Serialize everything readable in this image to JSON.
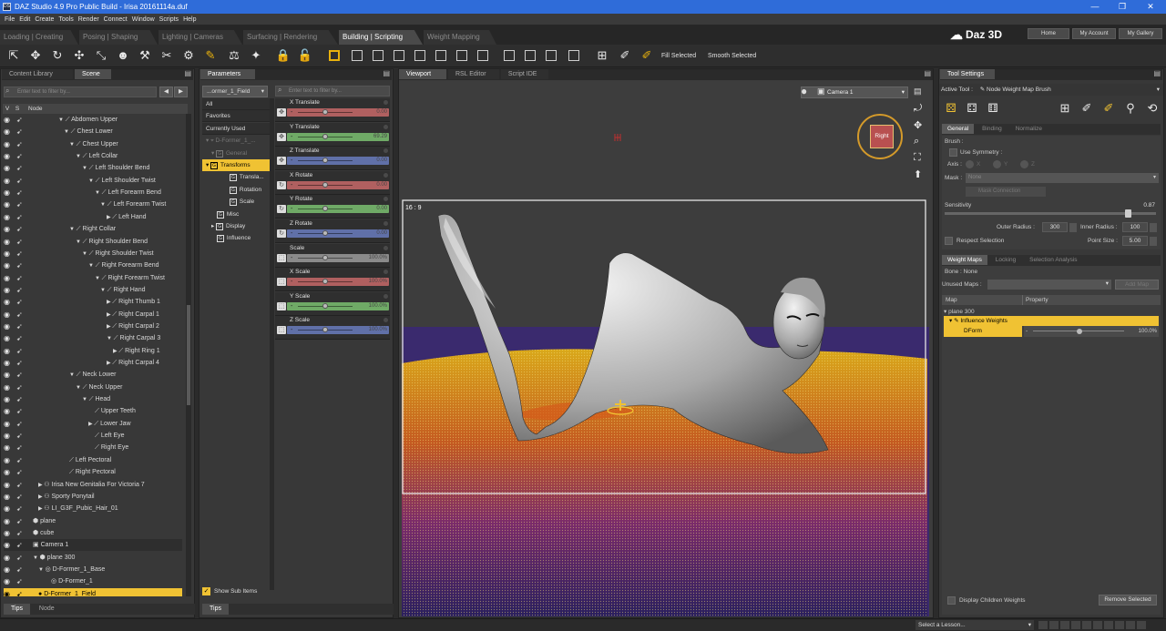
{
  "window": {
    "title": "DAZ Studio 4.9 Pro Public Build - Irisa 20161114a.duf",
    "app_icon": "DS"
  },
  "menu": [
    "File",
    "Edit",
    "Create",
    "Tools",
    "Render",
    "Connect",
    "Window",
    "Scripts",
    "Help"
  ],
  "rooms": [
    {
      "label": "Loading | Creating",
      "active": false
    },
    {
      "label": "Posing | Shaping",
      "active": false
    },
    {
      "label": "Lighting | Cameras",
      "active": false
    },
    {
      "label": "Surfacing | Rendering",
      "active": false
    },
    {
      "label": "Building | Scripting",
      "active": true
    },
    {
      "label": "Weight Mapping",
      "active": false
    }
  ],
  "top_buttons": {
    "home": "Home",
    "account": "My Account",
    "gallery": "My Gallery",
    "logo": "Daz 3D"
  },
  "toolbar": {
    "fill_selected": "Fill Selected",
    "smooth_selected": "Smooth Selected"
  },
  "left_panel": {
    "tabs": [
      "Content Library",
      "Scene"
    ],
    "filter_placeholder": "Enter text to filter by...",
    "header": {
      "v": "V",
      "s": "S",
      "node": "Node"
    },
    "nodes": [
      {
        "label": "Abdomen Upper",
        "indent": 60,
        "arrow": "▼",
        "icon": "bone"
      },
      {
        "label": "Chest Lower",
        "indent": 66,
        "arrow": "▼",
        "icon": "bone"
      },
      {
        "label": "Chest Upper",
        "indent": 72,
        "arrow": "▼",
        "icon": "bone"
      },
      {
        "label": "Left Collar",
        "indent": 79,
        "arrow": "▼",
        "icon": "bone"
      },
      {
        "label": "Left Shoulder Bend",
        "indent": 86,
        "arrow": "▼",
        "icon": "bone"
      },
      {
        "label": "Left Shoulder Twist",
        "indent": 93,
        "arrow": "▼",
        "icon": "bone"
      },
      {
        "label": "Left Forearm Bend",
        "indent": 100,
        "arrow": "▼",
        "icon": "bone"
      },
      {
        "label": "Left Forearm Twist",
        "indent": 106,
        "arrow": "▼",
        "icon": "bone"
      },
      {
        "label": "Left Hand",
        "indent": 113,
        "arrow": "▶",
        "icon": "bone"
      },
      {
        "label": "Right Collar",
        "indent": 72,
        "arrow": "▼",
        "icon": "bone"
      },
      {
        "label": "Right Shoulder Bend",
        "indent": 79,
        "arrow": "▼",
        "icon": "bone"
      },
      {
        "label": "Right Shoulder Twist",
        "indent": 86,
        "arrow": "▼",
        "icon": "bone"
      },
      {
        "label": "Right Forearm Bend",
        "indent": 93,
        "arrow": "▼",
        "icon": "bone"
      },
      {
        "label": "Right Forearm Twist",
        "indent": 100,
        "arrow": "▼",
        "icon": "bone"
      },
      {
        "label": "Right Hand",
        "indent": 106,
        "arrow": "▼",
        "icon": "bone"
      },
      {
        "label": "Right Thumb 1",
        "indent": 113,
        "arrow": "▶",
        "icon": "bone"
      },
      {
        "label": "Right Carpal 1",
        "indent": 113,
        "arrow": "▶",
        "icon": "bone"
      },
      {
        "label": "Right Carpal 2",
        "indent": 113,
        "arrow": "▶",
        "icon": "bone"
      },
      {
        "label": "Right Carpal 3",
        "indent": 113,
        "arrow": "▼",
        "icon": "bone"
      },
      {
        "label": "Right Ring 1",
        "indent": 120,
        "arrow": "▶",
        "icon": "bone"
      },
      {
        "label": "Right Carpal 4",
        "indent": 113,
        "arrow": "▶",
        "icon": "bone"
      },
      {
        "label": "Neck Lower",
        "indent": 72,
        "arrow": "▼",
        "icon": "bone"
      },
      {
        "label": "Neck Upper",
        "indent": 79,
        "arrow": "▼",
        "icon": "bone"
      },
      {
        "label": "Head",
        "indent": 86,
        "arrow": "▼",
        "icon": "bone"
      },
      {
        "label": "Upper Teeth",
        "indent": 100,
        "arrow": "",
        "icon": "bone"
      },
      {
        "label": "Lower Jaw",
        "indent": 93,
        "arrow": "▶",
        "icon": "bone"
      },
      {
        "label": "Left Eye",
        "indent": 100,
        "arrow": "",
        "icon": "bone"
      },
      {
        "label": "Right Eye",
        "indent": 100,
        "arrow": "",
        "icon": "bone"
      },
      {
        "label": "Left Pectoral",
        "indent": 72,
        "arrow": "",
        "icon": "bone"
      },
      {
        "label": "Right Pectoral",
        "indent": 72,
        "arrow": "",
        "icon": "bone"
      },
      {
        "label": "Irisa New Genitalia For Victoria 7",
        "indent": 38,
        "arrow": "▶",
        "icon": "figure"
      },
      {
        "label": "Sporty Ponytail",
        "indent": 38,
        "arrow": "▶",
        "icon": "figure"
      },
      {
        "label": "LI_G3F_Pubic_Hair_01",
        "indent": 38,
        "arrow": "▶",
        "icon": "figure"
      },
      {
        "label": "plane",
        "indent": 32,
        "arrow": "",
        "icon": "prop"
      },
      {
        "label": "cube",
        "indent": 32,
        "arrow": "",
        "icon": "prop"
      },
      {
        "label": "Camera 1",
        "indent": 32,
        "arrow": "",
        "icon": "camera"
      },
      {
        "label": "plane 300",
        "indent": 32,
        "arrow": "▼",
        "icon": "prop"
      },
      {
        "label": "D-Former_1_Base",
        "indent": 38,
        "arrow": "▼",
        "icon": "dformer"
      },
      {
        "label": "D-Former_1",
        "indent": 52,
        "arrow": "",
        "icon": "dformer"
      },
      {
        "label": "D-Former_1_Field",
        "indent": 38,
        "arrow": "",
        "icon": "field",
        "highlight": true
      }
    ],
    "bottom_tabs": [
      "Tips",
      "Node"
    ]
  },
  "params_panel": {
    "tab": "Parameters",
    "node_select": "...ormer_1_Field",
    "filter_placeholder": "Enter text to filter by...",
    "categories": [
      {
        "label": "All"
      },
      {
        "label": "Favorites"
      },
      {
        "label": "Currently Used"
      },
      {
        "label": "D-Former_1_...",
        "dim": true
      },
      {
        "label": "General",
        "dim": true
      },
      {
        "label": "Transforms",
        "highlight": true
      },
      {
        "label": "Transla..."
      },
      {
        "label": "Rotation"
      },
      {
        "label": "Scale"
      },
      {
        "label": "Misc"
      },
      {
        "label": "Display"
      },
      {
        "label": "Influence"
      }
    ],
    "rows": [
      {
        "label": "X Translate",
        "value": "0.00",
        "color": "#b06060",
        "icon": "move",
        "knob": 0.5
      },
      {
        "label": "Y Translate",
        "value": "69.29",
        "color": "#6faa66",
        "icon": "move",
        "knob": 0.5
      },
      {
        "label": "Z Translate",
        "value": "0.00",
        "color": "#6070a8",
        "icon": "move",
        "knob": 0.5
      },
      {
        "label": "X Rotate",
        "value": "0.00",
        "color": "#b06060",
        "icon": "rotate",
        "knob": 0.5
      },
      {
        "label": "Y Rotate",
        "value": "0.00",
        "color": "#6faa66",
        "icon": "rotate",
        "knob": 0.5
      },
      {
        "label": "Z Rotate",
        "value": "0.00",
        "color": "#6070a8",
        "icon": "rotate",
        "knob": 0.5
      },
      {
        "label": "Scale",
        "value": "100.0%",
        "color": "#8a8a8a",
        "icon": "scale",
        "knob": 0.5
      },
      {
        "label": "X Scale",
        "value": "100.0%",
        "color": "#b06060",
        "icon": "scale",
        "knob": 0.5
      },
      {
        "label": "Y Scale",
        "value": "100.0%",
        "color": "#6faa66",
        "icon": "scale",
        "knob": 0.5
      },
      {
        "label": "Z Scale",
        "value": "100.0%",
        "color": "#6070a8",
        "icon": "scale",
        "knob": 0.5
      }
    ],
    "show_sub_items": "Show Sub Items",
    "bottom_tab": "Tips"
  },
  "viewport": {
    "tabs": [
      "Viewport",
      "RSL Editor",
      "Script IDE"
    ],
    "camera": "Camera 1",
    "aspect": "16 : 9",
    "cube_label": "Right"
  },
  "tool_settings": {
    "title": "Tool Settings",
    "active_tool_label": "Active Tool :",
    "active_tool": "Node Weight Map Brush",
    "tabs": [
      "General",
      "Binding",
      "Normalize"
    ],
    "brush_label": "Brush :",
    "use_symmetry": "Use Symmetry :",
    "axis_label": "Axis :",
    "axis_options": [
      "X",
      "Y",
      "Z"
    ],
    "mask_label": "Mask :",
    "mask_value": "None",
    "mask_connection": "Mask Connection",
    "sensitivity_label": "Sensitivity",
    "sensitivity_value": "0.87",
    "sensitivity_fraction": 0.87,
    "outer_radius_label": "Outer Radius :",
    "outer_radius": "300",
    "inner_radius_label": "Inner Radius :",
    "inner_radius": "100",
    "respect_selection": "Respect Selection",
    "point_size_label": "Point Size :",
    "point_size": "5.00"
  },
  "weight_maps": {
    "tabs": [
      "Weight Maps",
      "Locking",
      "Selection Analysis"
    ],
    "bone": "Bone : None",
    "unused_label": "Unused Maps :",
    "add_map": "Add Map",
    "columns": [
      "Map",
      "Property"
    ],
    "tree": [
      {
        "label": "plane 300"
      },
      {
        "label": "Influence Weights"
      },
      {
        "label": "DForm",
        "value": "100.0%"
      }
    ],
    "display_children": "Display Children Weights",
    "remove_selected": "Remove Selected"
  },
  "status": {
    "lesson": "Select a Lesson..."
  },
  "colors": {
    "accent": "#f0c233",
    "titlebar": "#2f6cd9",
    "panel": "#383838"
  }
}
